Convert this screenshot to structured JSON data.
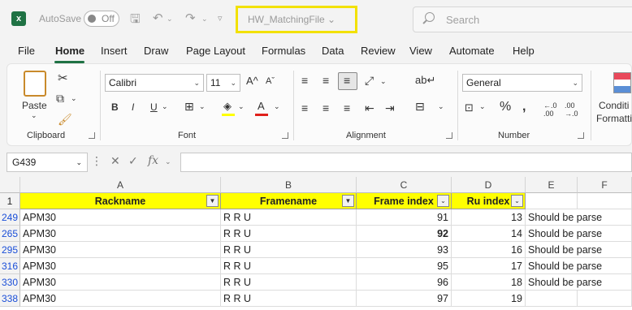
{
  "titlebar": {
    "autosave_label": "AutoSave",
    "autosave_state": "Off",
    "filename": "HW_MatchingFile",
    "search_placeholder": "Search"
  },
  "menu": {
    "items": [
      "File",
      "Home",
      "Insert",
      "Draw",
      "Page Layout",
      "Formulas",
      "Data",
      "Review",
      "View",
      "Automate",
      "Help"
    ],
    "active": "Home"
  },
  "ribbon": {
    "clipboard": {
      "label": "Clipboard",
      "paste": "Paste"
    },
    "font": {
      "label": "Font",
      "name": "Calibri",
      "size": "11"
    },
    "alignment": {
      "label": "Alignment"
    },
    "number": {
      "label": "Number",
      "format": "General"
    },
    "styles": {
      "conditional": "Conditi",
      "formatting": "Formatti"
    }
  },
  "formula_bar": {
    "name_box": "G439",
    "formula": ""
  },
  "grid": {
    "columns": [
      "A",
      "B",
      "C",
      "D",
      "E",
      "F"
    ],
    "header_row_num": "1",
    "headers": [
      "Rackname",
      "Framename",
      "Frame index",
      "Ru index"
    ],
    "rows": [
      {
        "num": "249",
        "rack": "APM30",
        "frame": "R R U",
        "frame_index": "91",
        "ru_index": "13",
        "note": "Should be parse"
      },
      {
        "num": "265",
        "rack": "APM30",
        "frame": "R R U",
        "frame_index": "92",
        "ru_index": "14",
        "note": "Should be parse"
      },
      {
        "num": "295",
        "rack": "APM30",
        "frame": "R R U",
        "frame_index": "93",
        "ru_index": "16",
        "note": "Should be parse"
      },
      {
        "num": "316",
        "rack": "APM30",
        "frame": "R R U",
        "frame_index": "95",
        "ru_index": "17",
        "note": "Should be parse"
      },
      {
        "num": "330",
        "rack": "APM30",
        "frame": "R R U",
        "frame_index": "96",
        "ru_index": "18",
        "note": "Should be parse"
      },
      {
        "num": "338",
        "rack": "APM30",
        "frame": "R R U",
        "frame_index": "97",
        "ru_index": "19",
        "note": ""
      }
    ]
  },
  "colors": {
    "header_fill": "#ffff00",
    "accent": "#1f7244",
    "filename_highlight": "#f2e100"
  }
}
